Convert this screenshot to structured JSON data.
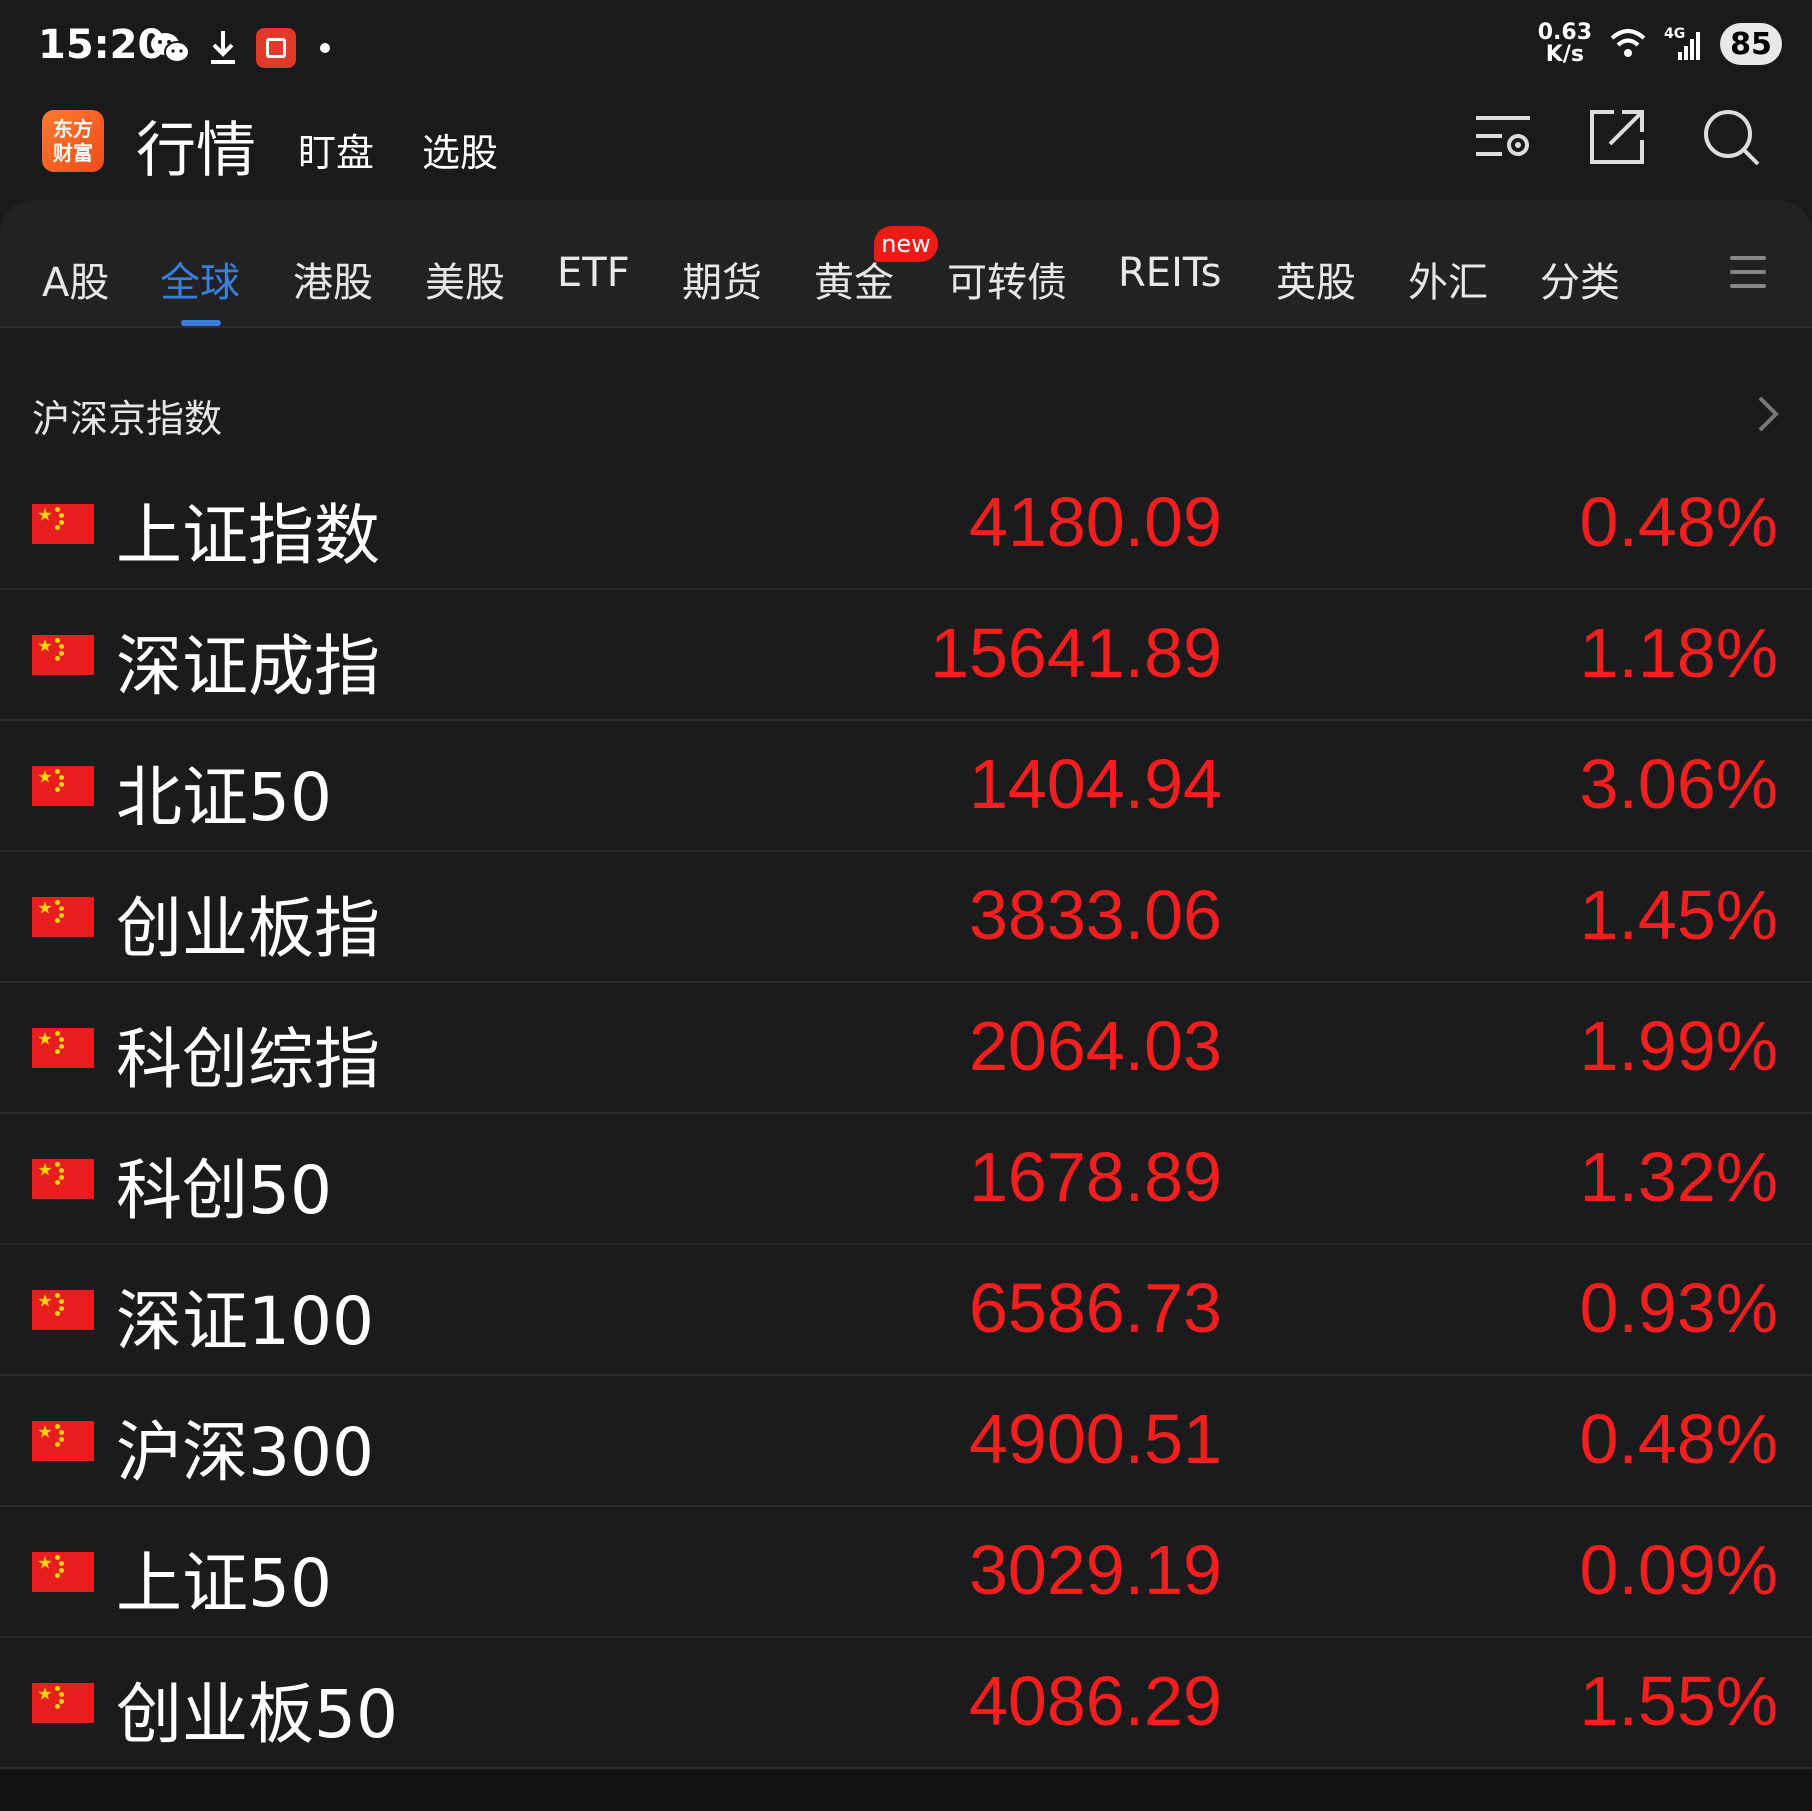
{
  "status_bar": {
    "time": "15:20",
    "speed_value": "0.63",
    "speed_unit": "K/s",
    "network": "4G",
    "battery": "85",
    "icons": [
      "wechat-icon",
      "download-icon",
      "app-notification-icon",
      "dot-icon",
      "wifi-icon",
      "signal-icon"
    ]
  },
  "header": {
    "logo_line1": "东方",
    "logo_line2": "财富",
    "title": "行情",
    "tabs": [
      "盯盘",
      "选股"
    ],
    "icons": [
      "list-settings-icon",
      "share-icon",
      "search-icon"
    ]
  },
  "market_tabs": {
    "items": [
      "A股",
      "全球",
      "港股",
      "美股",
      "ETF",
      "期货",
      "黄金",
      "可转债",
      "REITs",
      "英股",
      "外汇",
      "分类"
    ],
    "active": "全球",
    "badge": "new"
  },
  "section": {
    "title": "沪深京指数",
    "rows": [
      {
        "name": "上证指数",
        "price": "4180.09",
        "change": "0.48%"
      },
      {
        "name": "深证成指",
        "price": "15641.89",
        "change": "1.18%"
      },
      {
        "name": "北证50",
        "price": "1404.94",
        "change": "3.06%"
      },
      {
        "name": "创业板指",
        "price": "3833.06",
        "change": "1.45%"
      },
      {
        "name": "科创综指",
        "price": "2064.03",
        "change": "1.99%"
      },
      {
        "name": "科创50",
        "price": "1678.89",
        "change": "1.32%"
      },
      {
        "name": "深证100",
        "price": "6586.73",
        "change": "0.93%"
      },
      {
        "name": "沪深300",
        "price": "4900.51",
        "change": "0.48%"
      },
      {
        "name": "上证50",
        "price": "3029.19",
        "change": "0.09%"
      },
      {
        "name": "创业板50",
        "price": "4086.29",
        "change": "1.55%"
      }
    ]
  },
  "colors": {
    "up": "#f31e1e",
    "accent": "#3b7fdd",
    "badge": "#ee1a14",
    "background": "#1a1a1c"
  }
}
